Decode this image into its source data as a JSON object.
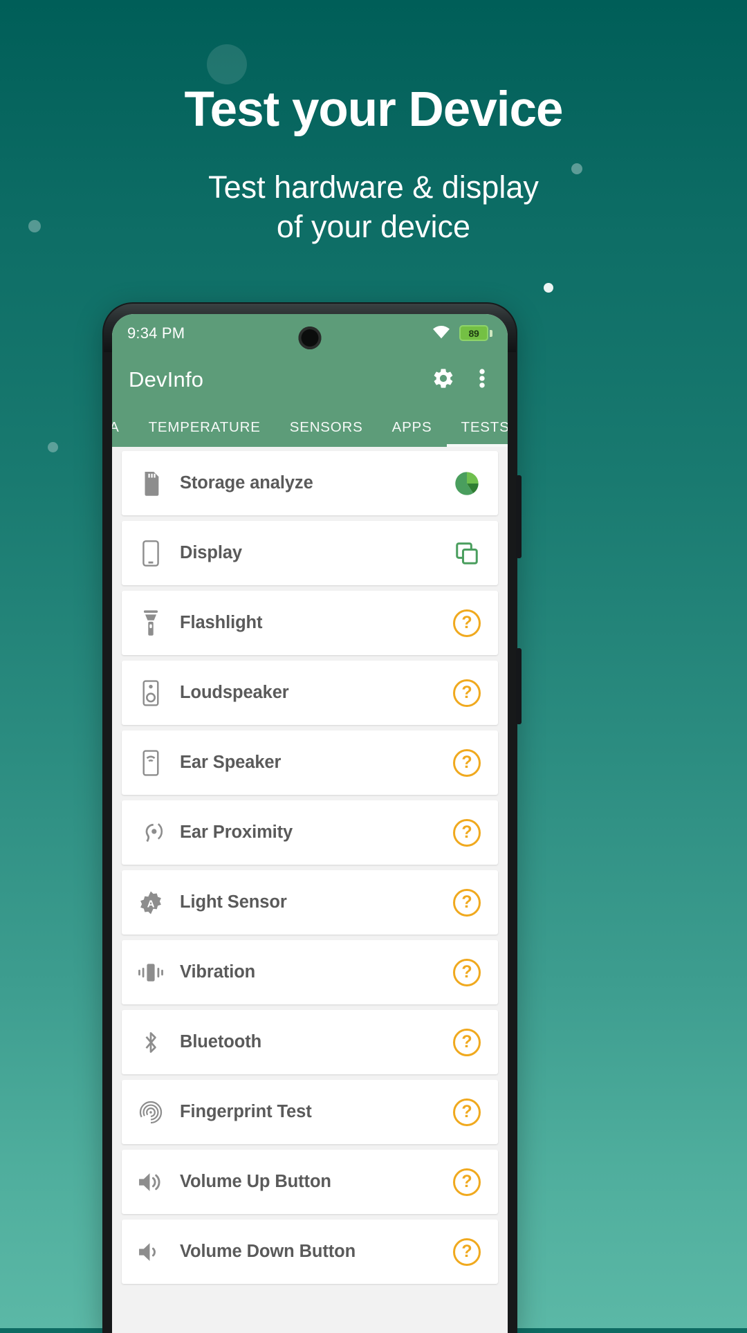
{
  "hero": {
    "title": "Test your Device",
    "subtitle_line1": "Test hardware & display",
    "subtitle_line2": "of your device",
    "background_top_color": "#005e58",
    "background_bottom_color": "#5bb8a6"
  },
  "phone": {
    "status_bar": {
      "time": "9:34 PM",
      "wifi_icon": "wifi-icon",
      "battery_level": "89",
      "battery_icon": "battery-icon",
      "camera_icon": "front-camera-punch-hole"
    },
    "app_bar": {
      "title": "DevInfo",
      "settings_icon": "gear-icon",
      "overflow_icon": "more-vertical-icon"
    },
    "tabs": [
      {
        "label": "ERA",
        "active": false,
        "partial": true
      },
      {
        "label": "TEMPERATURE",
        "active": false,
        "partial": false
      },
      {
        "label": "SENSORS",
        "active": false,
        "partial": false
      },
      {
        "label": "APPS",
        "active": false,
        "partial": false
      },
      {
        "label": "TESTS",
        "active": true,
        "partial": false
      }
    ],
    "tests": [
      {
        "label": "Storage analyze",
        "icon": "sd-card-icon",
        "status_icon": "pie-chart-icon"
      },
      {
        "label": "Display",
        "icon": "smartphone-icon",
        "status_icon": "duplicate-icon"
      },
      {
        "label": "Flashlight",
        "icon": "flashlight-icon",
        "status_icon": "question-mark-icon"
      },
      {
        "label": "Loudspeaker",
        "icon": "speaker-icon",
        "status_icon": "question-mark-icon"
      },
      {
        "label": "Ear Speaker",
        "icon": "ear-speaker-icon",
        "status_icon": "question-mark-icon"
      },
      {
        "label": "Ear Proximity",
        "icon": "proximity-icon",
        "status_icon": "question-mark-icon"
      },
      {
        "label": "Light Sensor",
        "icon": "brightness-icon",
        "status_icon": "question-mark-icon"
      },
      {
        "label": "Vibration",
        "icon": "vibration-icon",
        "status_icon": "question-mark-icon"
      },
      {
        "label": "Bluetooth",
        "icon": "bluetooth-icon",
        "status_icon": "question-mark-icon"
      },
      {
        "label": "Fingerprint Test",
        "icon": "fingerprint-icon",
        "status_icon": "question-mark-icon"
      },
      {
        "label": "Volume Up Button",
        "icon": "volume-up-icon",
        "status_icon": "question-mark-icon"
      },
      {
        "label": "Volume Down Button",
        "icon": "volume-down-icon",
        "status_icon": "question-mark-icon"
      }
    ],
    "question_mark_glyph": "?",
    "accent_color": "#5d9c79",
    "status_warning_color": "#f0a91e"
  }
}
